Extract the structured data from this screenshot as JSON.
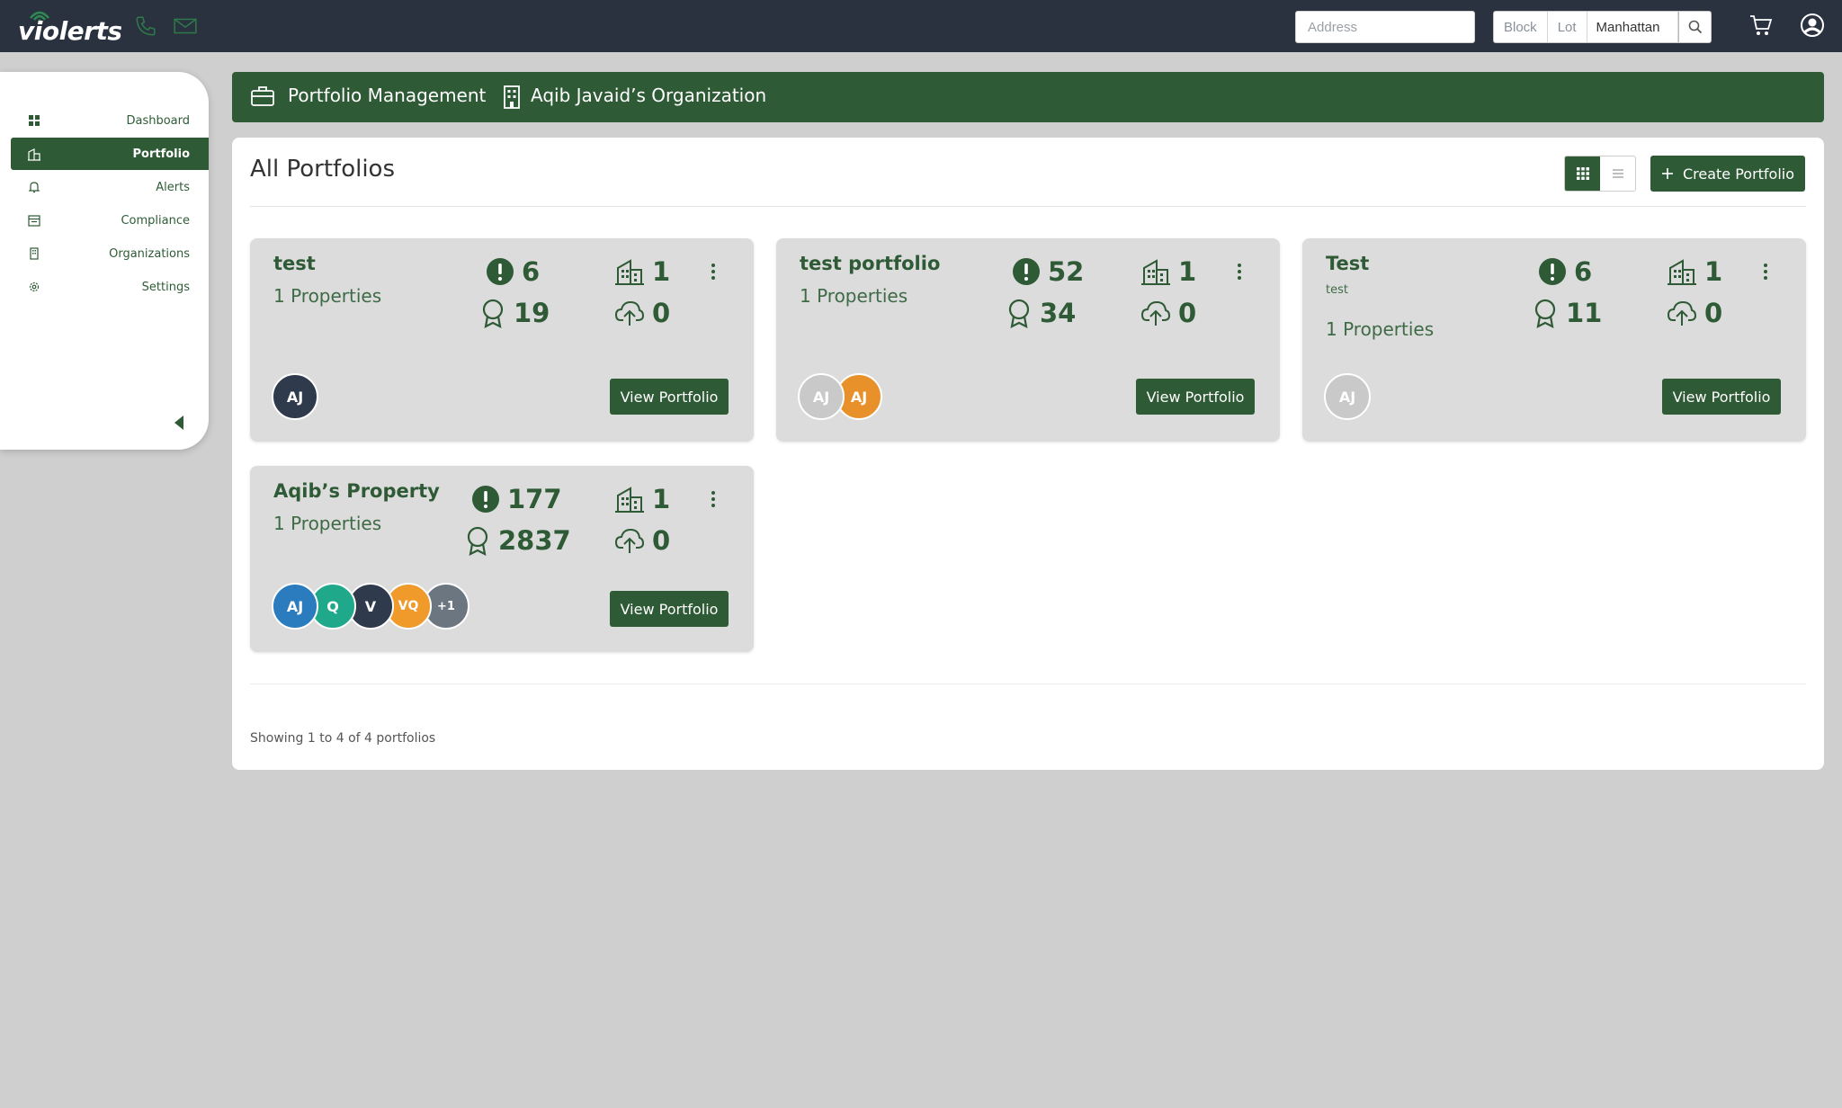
{
  "app": {
    "logo_text": "violerts"
  },
  "topbar": {
    "address_placeholder": "Address",
    "block_label": "Block",
    "lot_label": "Lot",
    "borough_value": "Manhattan"
  },
  "sidebar": {
    "items": [
      {
        "label": "Dashboard",
        "icon": "grid-icon",
        "active": false
      },
      {
        "label": "Portfolio",
        "icon": "buildings-icon",
        "active": true
      },
      {
        "label": "Alerts",
        "icon": "bell-icon",
        "active": false
      },
      {
        "label": "Compliance",
        "icon": "calendar-icon",
        "active": false
      },
      {
        "label": "Organizations",
        "icon": "building-icon",
        "active": false
      },
      {
        "label": "Settings",
        "icon": "gear-icon",
        "active": false
      }
    ]
  },
  "banner": {
    "section": "Portfolio Management",
    "organization": "Aqib Javaid’s Organization"
  },
  "main": {
    "title": "All Portfolios",
    "create_label": "Create Portfolio",
    "showing": "Showing 1 to 4 of 4 portfolios"
  },
  "portfolios": [
    {
      "name": "test",
      "description": "",
      "properties": "1 Properties",
      "alerts": "6",
      "buildings": "1",
      "certificates": "19",
      "uploads": "0",
      "avatars": [
        {
          "initials": "AJ",
          "color": "#2f3a4c"
        }
      ],
      "button": "View Portfolio"
    },
    {
      "name": "test portfolio",
      "description": "",
      "properties": "1 Properties",
      "alerts": "52",
      "buildings": "1",
      "certificates": "34",
      "uploads": "0",
      "avatars": [
        {
          "initials": "AJ",
          "color": "#c9c9c9"
        },
        {
          "initials": "AJ",
          "color": "#e8912a"
        }
      ],
      "button": "View Portfolio"
    },
    {
      "name": "Test",
      "description": "test",
      "properties": "1 Properties",
      "alerts": "6",
      "buildings": "1",
      "certificates": "11",
      "uploads": "0",
      "avatars": [
        {
          "initials": "AJ",
          "color": "#c9c9c9"
        }
      ],
      "button": "View Portfolio"
    },
    {
      "name": "Aqib’s Property",
      "description": "",
      "properties": "1 Properties",
      "alerts": "177",
      "buildings": "1",
      "certificates": "2837",
      "uploads": "0",
      "avatars": [
        {
          "initials": "AJ",
          "color": "#2a7cbf"
        },
        {
          "initials": "Q",
          "color": "#1fa88a"
        },
        {
          "initials": "V",
          "color": "#2f3a4c"
        },
        {
          "initials": "VQ",
          "color": "#ef9a2b"
        },
        {
          "initials": "+1",
          "color": "#6b7680"
        }
      ],
      "button": "View Portfolio"
    }
  ],
  "colors": {
    "brand_green": "#2e5a35",
    "navbar": "#2a3240",
    "page_bg": "#cfcfcf"
  }
}
